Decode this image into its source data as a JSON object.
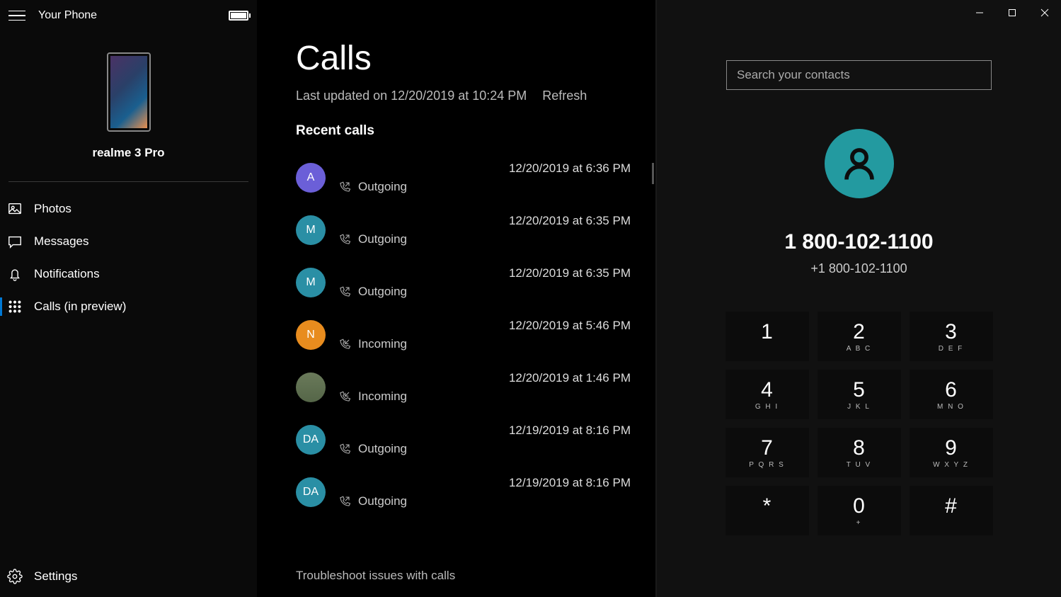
{
  "app_title": "Your Phone",
  "device_name": "realme 3 Pro",
  "nav": [
    {
      "label": "Photos",
      "icon": "photos"
    },
    {
      "label": "Messages",
      "icon": "messages"
    },
    {
      "label": "Notifications",
      "icon": "notifications"
    },
    {
      "label": "Calls (in preview)",
      "icon": "calls",
      "active": true
    }
  ],
  "settings_label": "Settings",
  "page_title": "Calls",
  "last_updated": "Last updated on 12/20/2019 at 10:24 PM",
  "refresh_label": "Refresh",
  "recent_calls_title": "Recent calls",
  "calls": [
    {
      "initial": "A",
      "color": "#6b5fd8",
      "time": "12/20/2019 at 6:36 PM",
      "direction": "Outgoing"
    },
    {
      "initial": "M",
      "color": "#2a8fa5",
      "time": "12/20/2019 at 6:35 PM",
      "direction": "Outgoing"
    },
    {
      "initial": "M",
      "color": "#2a8fa5",
      "time": "12/20/2019 at 6:35 PM",
      "direction": "Outgoing"
    },
    {
      "initial": "N",
      "color": "#e88c1e",
      "time": "12/20/2019 at 5:46 PM",
      "direction": "Incoming"
    },
    {
      "photo": true,
      "time": "12/20/2019 at 1:46 PM",
      "direction": "Incoming"
    },
    {
      "initial": "DA",
      "color": "#2a8fa5",
      "time": "12/19/2019 at 8:16 PM",
      "direction": "Outgoing"
    },
    {
      "initial": "DA",
      "color": "#2a8fa5",
      "time": "12/19/2019 at 8:16 PM",
      "direction": "Outgoing"
    }
  ],
  "troubleshoot_label": "Troubleshoot issues with calls",
  "search_placeholder": "Search your contacts",
  "contact_number": "1 800-102-1100",
  "contact_subnumber": "+1 800-102-1100",
  "dialpad": [
    {
      "digit": "1",
      "letters": ""
    },
    {
      "digit": "2",
      "letters": "A B C"
    },
    {
      "digit": "3",
      "letters": "D E F"
    },
    {
      "digit": "4",
      "letters": "G H I"
    },
    {
      "digit": "5",
      "letters": "J K L"
    },
    {
      "digit": "6",
      "letters": "M N O"
    },
    {
      "digit": "7",
      "letters": "P Q R S"
    },
    {
      "digit": "8",
      "letters": "T U V"
    },
    {
      "digit": "9",
      "letters": "W X Y Z"
    },
    {
      "digit": "*",
      "letters": ""
    },
    {
      "digit": "0",
      "letters": "+"
    },
    {
      "digit": "#",
      "letters": ""
    }
  ]
}
